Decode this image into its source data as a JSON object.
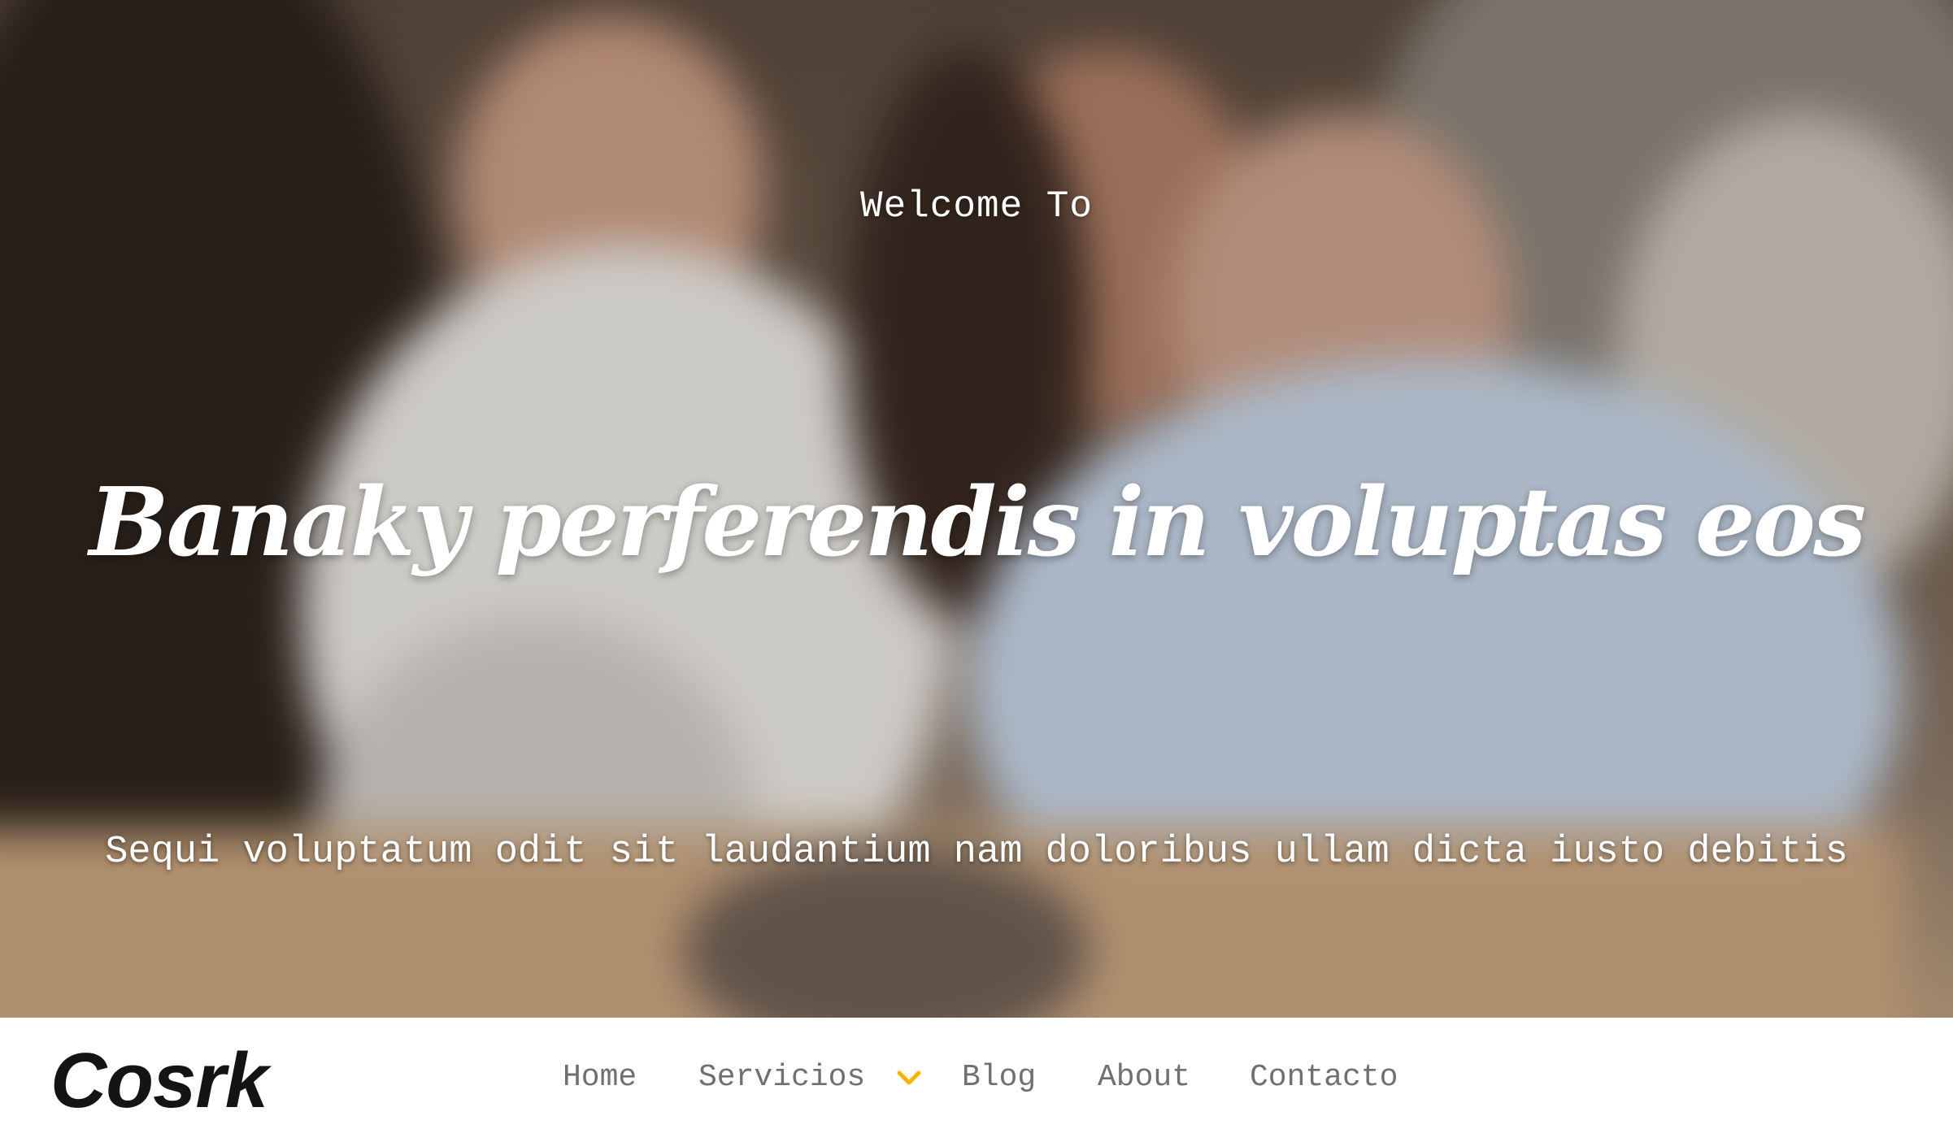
{
  "hero": {
    "welcome": "Welcome To",
    "headline": "Banaky perferendis in voluptas eos",
    "subtitle": "Sequi voluptatum odit sit laudantium nam doloribus ullam dicta iusto debitis"
  },
  "navbar": {
    "logo": "Cosrk",
    "items": [
      {
        "label": "Home"
      },
      {
        "label": "Servicios",
        "dropdown_icon": "chevron-down-icon"
      },
      {
        "label": "Blog"
      },
      {
        "label": "About"
      },
      {
        "label": "Contacto"
      }
    ]
  },
  "colors": {
    "accent": "#f4b400",
    "nav_text": "#707070",
    "logo": "#141414",
    "hero_text": "#ffffff"
  }
}
